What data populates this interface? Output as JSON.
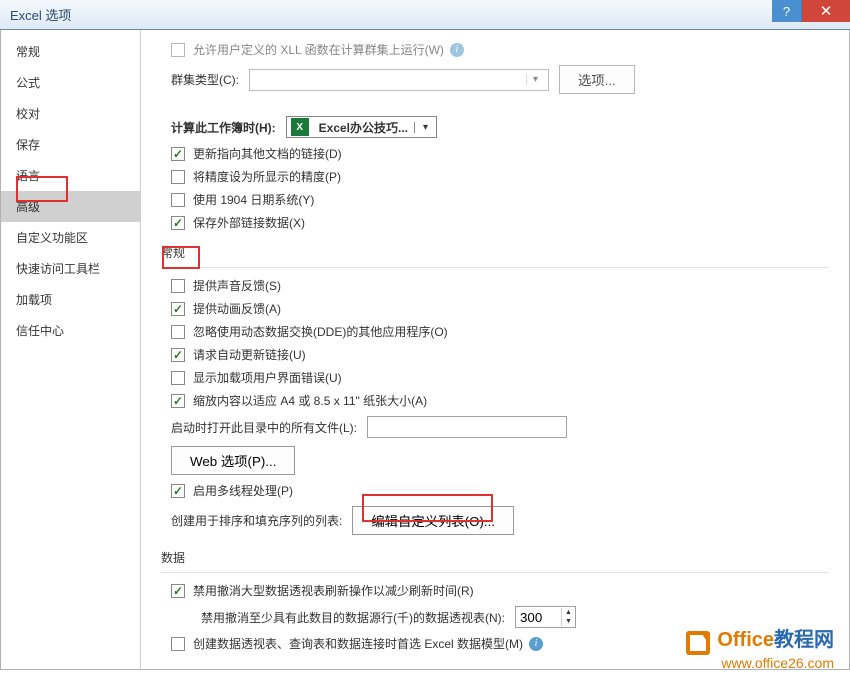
{
  "title": "Excel 选项",
  "titlebar": {
    "help": "?",
    "close": "✕"
  },
  "sidebar": {
    "items": [
      {
        "label": "常规"
      },
      {
        "label": "公式"
      },
      {
        "label": "校对"
      },
      {
        "label": "保存"
      },
      {
        "label": "语言"
      },
      {
        "label": "高级",
        "selected": true
      },
      {
        "label": "自定义功能区"
      },
      {
        "label": "快速访问工具栏"
      },
      {
        "label": "加载项"
      },
      {
        "label": "信任中心"
      }
    ]
  },
  "top": {
    "allow_xll": "允许用户定义的 XLL 函数在计算群集上运行(W)",
    "cluster_type_label": "群集类型(C):",
    "options_btn": "选项..."
  },
  "calc_section": {
    "label": "计算此工作簿时(H):",
    "workbook": "Excel办公技巧...",
    "update_links": "更新指向其他文档的链接(D)",
    "precision": "将精度设为所显示的精度(P)",
    "date1904": "使用 1904 日期系统(Y)",
    "save_ext_links": "保存外部链接数据(X)"
  },
  "general_section": {
    "header": "常规",
    "sound_feedback": "提供声音反馈(S)",
    "anim_feedback": "提供动画反馈(A)",
    "ignore_dde": "忽略使用动态数据交换(DDE)的其他应用程序(O)",
    "auto_update_links": "请求自动更新链接(U)",
    "addon_ui_errors": "显示加载项用户界面错误(U)",
    "scale_a4": "缩放内容以适应 A4 或 8.5 x 11\" 纸张大小(A)",
    "startup_files_label": "启动时打开此目录中的所有文件(L):",
    "web_options_btn": "Web 选项(P)...",
    "multithread": "启用多线程处理(P)",
    "custom_list_label": "创建用于排序和填充序列的列表:",
    "edit_custom_list_btn": "编辑自定义列表(O)..."
  },
  "data_section": {
    "header": "数据",
    "disable_undo_large_pivot": "禁用撤消大型数据透视表刷新操作以减少刷新时间(R)",
    "disable_undo_rows_label": "禁用撤消至少具有此数目的数据源行(千)的数据透视表(N):",
    "rows_value": "300",
    "prefer_excel_model": "创建数据透视表、查询表和数据连接时首选 Excel 数据模型(M)"
  },
  "watermark": {
    "title_plain": "Office",
    "title_blue": "教程网",
    "url": "www.office26.com"
  }
}
